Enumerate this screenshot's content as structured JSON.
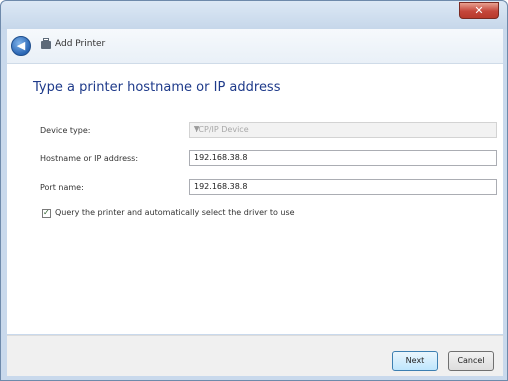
{
  "window": {
    "close_label": "✕"
  },
  "nav": {
    "back_label": "◀",
    "title": "Add Printer"
  },
  "content": {
    "heading": "Type a printer hostname or IP address",
    "device_type": {
      "label": "Device type:",
      "value": "TCP/IP Device"
    },
    "hostname": {
      "label": "Hostname or IP address:",
      "value": "192.168.38.8"
    },
    "port": {
      "label": "Port name:",
      "value": "192.168.38.8"
    },
    "query": {
      "checked_mark": "✓",
      "label": "Query the printer and automatically select the driver to use"
    }
  },
  "buttons": {
    "next": "Next",
    "cancel": "Cancel"
  },
  "colors": {
    "heading": "#1e3a8a",
    "frame": "#c9d9ec",
    "close": "#c4463a"
  },
  "icons": {
    "back": "back-arrow-icon",
    "printer": "printer-icon",
    "dropdown": "chevron-down-icon",
    "close": "close-icon"
  }
}
